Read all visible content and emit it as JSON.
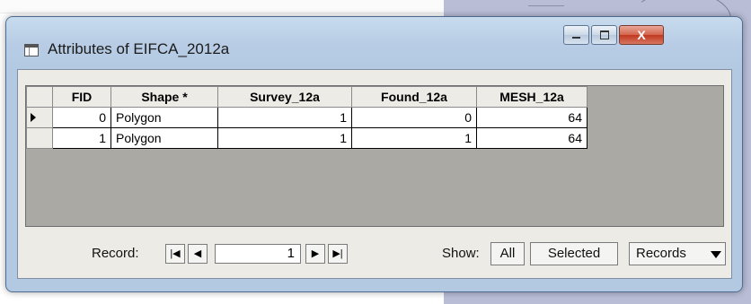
{
  "window": {
    "title": "Attributes of EIFCA_2012a",
    "close_glyph": "X"
  },
  "table": {
    "columns": [
      "FID",
      "Shape *",
      "Survey_12a",
      "Found_12a",
      "MESH_12a"
    ],
    "rows": [
      {
        "fid": "0",
        "shape": "Polygon",
        "survey": "1",
        "found": "0",
        "mesh": "64"
      },
      {
        "fid": "1",
        "shape": "Polygon",
        "survey": "1",
        "found": "1",
        "mesh": "64"
      }
    ]
  },
  "navigation": {
    "record_label": "Record:",
    "current_record": "1",
    "show_label": "Show:",
    "all_label": "All",
    "selected_label": "Selected",
    "records_label": "Records"
  }
}
